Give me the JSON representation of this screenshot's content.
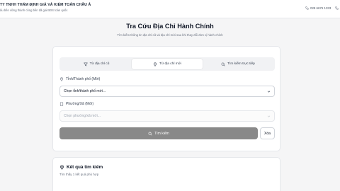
{
  "header": {
    "company_name": "TY TNHH THẨM ĐỊNH GIÁ VÀ KIỂM TOÁN CHÂU Á",
    "tagline": "ấu bền vững thành công bền đã giá BĐS toàn quốc",
    "phone": "028 6676 1333",
    "icons": {
      "phone": "phone-icon",
      "extra": "phone-icon"
    }
  },
  "hero": {
    "title": "Tra Cứu Địa Chỉ Hành Chính",
    "subtitle": "Tìm kiếm thông tin địa chỉ cũ và địa chỉ mới sau khi thay đổi đơn vị hành chính"
  },
  "tabs": [
    {
      "label": "Từ địa chỉ cũ",
      "icon": "filter-icon",
      "active": false
    },
    {
      "label": "Từ địa chỉ mới",
      "icon": "map-pin-icon",
      "active": true
    },
    {
      "label": "Tìm kiếm trực tiếp",
      "icon": "search-icon",
      "active": false
    }
  ],
  "form": {
    "province": {
      "label": "Tỉnh/Thành phố (Mới)",
      "value": "Chọn tỉnh/thành phố mới..."
    },
    "ward": {
      "label": "Phường/Xã (Mới)",
      "placeholder": "Chọn phường/xã mới..."
    },
    "search_button": "Tìm kiếm",
    "clear_button": "Xóa"
  },
  "results": {
    "title": "Kết quả tìm kiếm",
    "count_text": "Tìm thấy 1 kết quả phù hợp"
  },
  "colors": {
    "page_bg": "#f5f5f6",
    "search_button_bg": "#898989",
    "text_primary": "#111827",
    "text_muted": "#6b7280"
  }
}
